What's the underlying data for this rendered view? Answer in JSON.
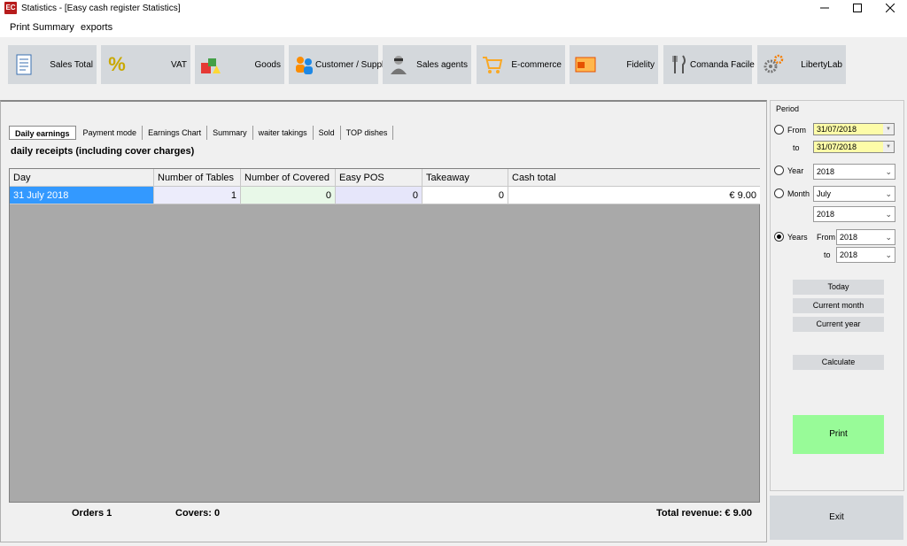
{
  "window": {
    "title": "Statistics - [Easy cash register Statistics]",
    "app_icon_text": "EC"
  },
  "menu": {
    "items": [
      "Print Summary",
      "exports"
    ]
  },
  "toolbar": [
    {
      "label": "Sales Total",
      "icon": "document-icon"
    },
    {
      "label": "VAT",
      "icon": "percent-icon"
    },
    {
      "label": "Goods",
      "icon": "goods-icon"
    },
    {
      "label": "Customer / Supplier",
      "icon": "people-icon"
    },
    {
      "label": "Sales agents",
      "icon": "agent-icon"
    },
    {
      "label": "E-commerce",
      "icon": "cart-icon"
    },
    {
      "label": "Fidelity",
      "icon": "card-icon"
    },
    {
      "label": "Comanda Facile",
      "icon": "cutlery-icon"
    },
    {
      "label": "LibertyLab",
      "icon": "gears-icon"
    }
  ],
  "tabs": [
    "Daily earnings",
    "Payment mode",
    "Earnings Chart",
    "Summary",
    "waiter takings",
    "Sold",
    "TOP dishes"
  ],
  "section_title": "daily receipts (including cover charges)",
  "table": {
    "columns": [
      "Day",
      "Number of Tables",
      "Number of Covered",
      "Easy POS",
      "Takeaway",
      "Cash total"
    ],
    "rows": [
      {
        "day": "31 July 2018",
        "tables": "1",
        "covered": "0",
        "easy_pos": "0",
        "takeaway": "0",
        "cash_total": "€ 9.00"
      }
    ]
  },
  "footer": {
    "orders": "Orders 1",
    "covers": "Covers: 0",
    "total": "Total revenue: € 9.00"
  },
  "period": {
    "legend": "Period",
    "from_label": "From",
    "from_value": "31/07/2018",
    "to_label": "to",
    "to_value": "31/07/2018",
    "year_label": "Year",
    "year_value": "2018",
    "month_label": "Month",
    "month_value": "July",
    "month_year_value": "2018",
    "years_label": "Years",
    "years_from_label": "From",
    "years_from_value": "2018",
    "years_to_label": "to",
    "years_to_value": "2018",
    "selected": "years"
  },
  "buttons": {
    "today": "Today",
    "current_month": "Current month",
    "current_year": "Current year",
    "calculate": "Calculate",
    "print": "Print",
    "exit": "Exit"
  },
  "colors": {
    "selected_row": "#3399ff",
    "date_bg": "#fdfca8",
    "print_bg": "#98fb98",
    "grid_bg": "#a9a9a9"
  }
}
